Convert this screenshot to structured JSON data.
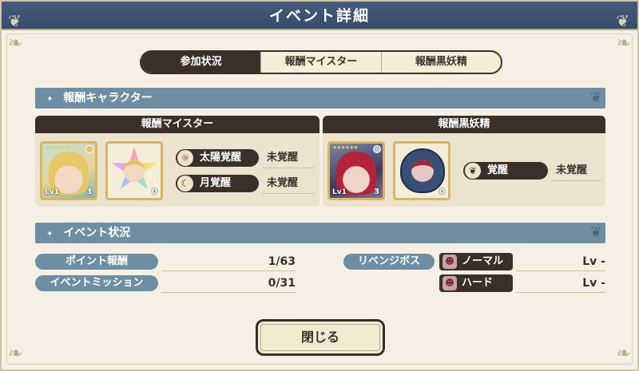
{
  "title": "イベント詳細",
  "tabs": [
    {
      "label": "参加状況"
    },
    {
      "label": "報酬マイスター"
    },
    {
      "label": "報酬黒妖精"
    }
  ],
  "reward_section": {
    "heading": "報酬キャラクター",
    "meister": {
      "header": "報酬マイスター",
      "card_level": "Lv1",
      "card_count": "3",
      "fragment_count": "0",
      "awakenings": [
        {
          "label": "太陽覚醒",
          "icon": "sun-icon",
          "value": "未覚醒"
        },
        {
          "label": "月覚醒",
          "icon": "moon-icon",
          "value": "未覚醒"
        }
      ]
    },
    "fairy": {
      "header": "報酬黒妖精",
      "card_level": "Lv1",
      "card_count": "3",
      "fragment_count": "0",
      "awakening": {
        "label": "覚醒",
        "icon": "leaf-icon",
        "value": "未覚醒"
      }
    }
  },
  "event_status": {
    "heading": "イベント状況",
    "rows": [
      {
        "label": "ポイント報酬",
        "value": "1/63"
      },
      {
        "label": "イベントミッション",
        "value": "0/31"
      }
    ],
    "revenge_boss": {
      "label": "リベンジボス",
      "difficulties": [
        {
          "label": "ノーマル",
          "level": "Lv -"
        },
        {
          "label": "ハード",
          "level": "Lv -"
        }
      ]
    }
  },
  "close_button": "閉じる",
  "colors": {
    "title_bar": "#3d5475",
    "section_bar": "#6e8fa3",
    "dark": "#3b3029",
    "panel": "#f5f0e3"
  }
}
